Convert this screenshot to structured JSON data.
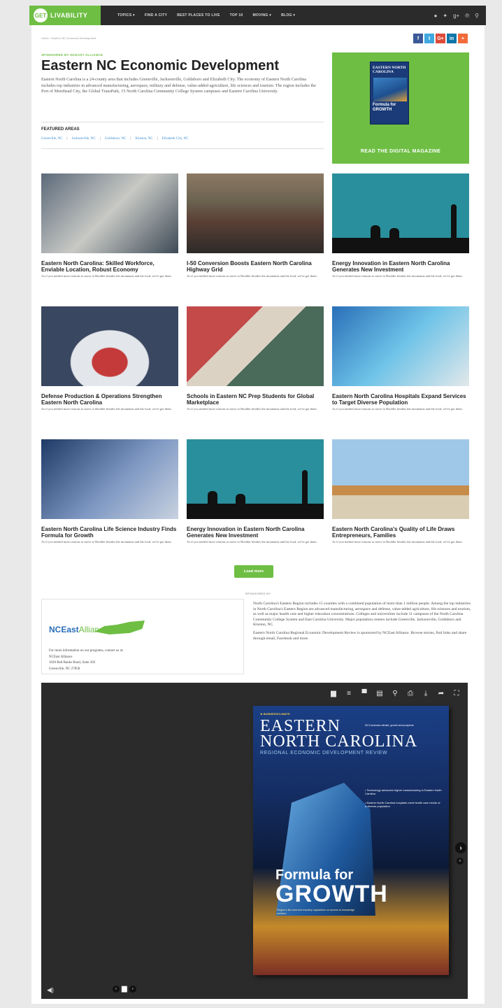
{
  "nav": {
    "logo_badge": "GET",
    "logo_text": "LIVABILITY",
    "links": [
      "TOPICS ▾",
      "FIND A CITY",
      "BEST PLACES TO LIVE",
      "TOP 10",
      "MOVING ▾",
      "BLOG ▾"
    ],
    "icons": [
      "facebook-icon",
      "twitter-icon",
      "google-plus-icon",
      "pinterest-icon",
      "search-icon"
    ]
  },
  "breadcrumb": "Home › Eastern NC Economic Development",
  "share": [
    {
      "icon": "facebook-icon",
      "glyph": "f",
      "color": "#3b5998"
    },
    {
      "icon": "twitter-icon",
      "glyph": "t",
      "color": "#3fa9e0"
    },
    {
      "icon": "google-plus-icon",
      "glyph": "G+",
      "color": "#dd4b39"
    },
    {
      "icon": "linkedin-icon",
      "glyph": "in",
      "color": "#0e76a8"
    },
    {
      "icon": "plus-icon",
      "glyph": "+",
      "color": "#f26b3a"
    }
  ],
  "header": {
    "sponsored": "SPONSORED BY NCEAST ALLIANCE",
    "title": "Eastern NC Economic Development",
    "intro": "Eastern North Carolina is a 24-county area that includes Greenville, Jacksonville, Goldsboro and Elizabeth City. The economy of Eastern North Carolina includes top industries in advanced manufacturing, aerospace, military and defense, value-added agriculture, life sciences and tourism. The region includes the Port of Morehead City, the Global TransPark, 15 North Carolina Community College System campuses and Eastern Carolina University."
  },
  "featured": {
    "label": "FEATURED AREAS",
    "links": [
      "Greenville, NC",
      "Jacksonville, NC",
      "Goldsboro, NC",
      "Kinston, NC",
      "Elizabeth City, NC"
    ]
  },
  "magazine": {
    "cover_title": "EASTERN NORTH CAROLINA",
    "cover_tagline": "Formula for GROWTH",
    "cta": "READ THE DIGITAL MAGAZINE"
  },
  "articles": [
    {
      "title": "Eastern North Carolina: Skilled Workforce, Enviable Location, Robust Economy",
      "desc": "As if you needed more reasons to move to Boulder besides the mountains and the food, we've got them."
    },
    {
      "title": "I-50 Conversion Boosts Eastern North Carolina Highway Grid",
      "desc": "As if you needed more reasons to move to Boulder besides the mountains and the food, we've got them."
    },
    {
      "title": "Energy Innovation in Eastern North Carolina Generates New Investment",
      "desc": "As if you needed more reasons to move to Boulder besides the mountains and the food, we've got them."
    },
    {
      "title": "Defense Production & Operations Strengthen Eastern North Carolina",
      "desc": "As if you needed more reasons to move to Boulder besides the mountains and the food, we've got them."
    },
    {
      "title": "Schools in Eastern NC Prep Students for Global Marketplace",
      "desc": "As if you needed more reasons to move to Boulder besides the mountains and the food, we've got them."
    },
    {
      "title": "Eastern North Carolina Hospitals Expand Services to Target Diverse Population",
      "desc": "As if you needed more reasons to move to Boulder besides the mountains and the food, we've got them."
    },
    {
      "title": "Eastern North Carolina Life Science Industry Finds Formula for Growth",
      "desc": "As if you needed more reasons to move to Boulder besides the mountains and the food, we've got them."
    },
    {
      "title": "Energy Innovation in Eastern North Carolina Generates New Investment",
      "desc": "As if you needed more reasons to move to Boulder besides the mountains and the food, we've got them."
    },
    {
      "title": "Eastern North Carolina's Quality of Life Draws Entrepreneurs, Families",
      "desc": "As if you needed more reasons to move to Boulder besides the mountains and the food, we've got them."
    }
  ],
  "load_more": "Load more",
  "sponsor": {
    "label": "SPONSORED BY",
    "logo_nc": "NCEast",
    "logo_alliance": "Alliance",
    "contact_line": "For more information on our programs, contact us at:",
    "org": "NCEast Alliance",
    "address1": "1020 Red Banks Road, Suite 202",
    "address2": "Greenville, NC 27858",
    "desc1": "North Carolina's Eastern Region includes 15 counties with a combined population of more than 1 million people. Among the top industries in North Carolina's Eastern Region are advanced manufacturing, aerospace and defense, value-added agriculture, life sciences and tourism, as well as major health care and higher education concentrations. Colleges and universities include 11 campuses of the North Carolina Community College System and East Carolina University. Major population centers include Greenville, Jacksonville, Goldsboro and Kinston, NC.",
    "desc2": "Eastern North Carolina Regional Economic Development Review is sponsored by NCEast Alliance. Browse stories, find links and share through email, Facebook and more."
  },
  "viewer": {
    "toolbar": [
      {
        "name": "book-icon",
        "glyph": "▆"
      },
      {
        "name": "list-icon",
        "glyph": "≡"
      },
      {
        "name": "pages-icon",
        "glyph": "▀"
      },
      {
        "name": "pdf-icon",
        "glyph": "▤"
      },
      {
        "name": "search-icon",
        "glyph": "⚲"
      },
      {
        "name": "print-icon",
        "glyph": "⎙"
      },
      {
        "name": "download-icon",
        "glyph": "⤓"
      },
      {
        "name": "share-icon",
        "glyph": "➦"
      },
      {
        "name": "fullscreen-icon",
        "glyph": "⛶"
      }
    ],
    "cover_kicker": "★ BUSINESSCLIMATE",
    "cover_line1": "EASTERN",
    "cover_line2": "NORTH CAROLINA",
    "cover_sub": "REGIONAL ECONOMIC DEVELOPMENT REVIEW",
    "cover_note": "NC's business climate, growth and prospects",
    "cover_bullets": [
      "• Technology advances higher manufacturing in Eastern North Carolina",
      "• Eastern North Carolina hospitals meet health care needs of a diverse population"
    ],
    "cover_formula": "Formula for",
    "cover_growth": "GROWTH",
    "cover_tag": "Region's life sciences industry capitalizes on access to knowledge workers",
    "next_glyph": "›",
    "end_glyph": "»",
    "sound_glyph": "◀)",
    "prev_glyph": "‹",
    "book_glyph": "▆",
    "fwd_glyph": "›"
  }
}
